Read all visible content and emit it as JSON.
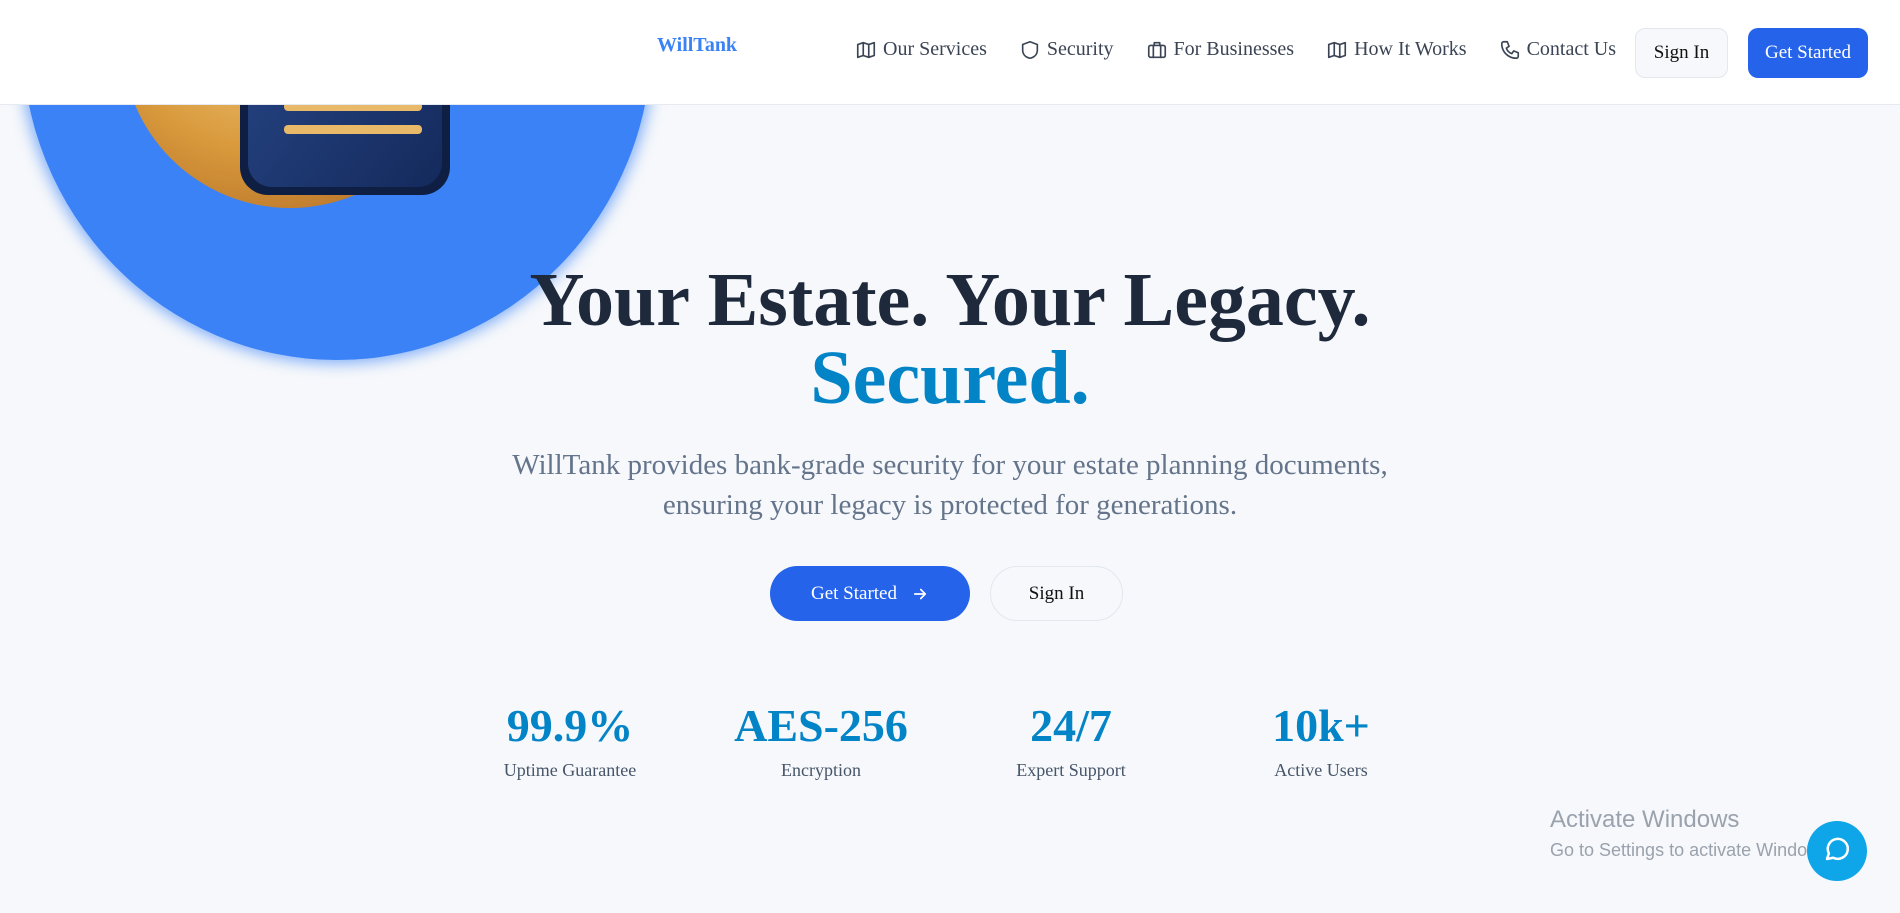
{
  "brand": {
    "name": "WillTank"
  },
  "nav": {
    "items": [
      {
        "label": "Our Services",
        "icon": "map-icon"
      },
      {
        "label": "Security",
        "icon": "shield-icon"
      },
      {
        "label": "For Businesses",
        "icon": "briefcase-icon"
      },
      {
        "label": "How It Works",
        "icon": "map-icon"
      },
      {
        "label": "Contact Us",
        "icon": "phone-icon"
      }
    ],
    "sign_in": "Sign In",
    "get_started": "Get Started"
  },
  "hero": {
    "title_line1": "Your Estate. Your Legacy.",
    "title_line2": "Secured.",
    "subtitle_line1": "WillTank provides bank-grade security for your estate planning documents,",
    "subtitle_line2": "ensuring your legacy is protected for generations.",
    "cta_primary": "Get Started",
    "cta_secondary": "Sign In"
  },
  "stats": [
    {
      "value": "99.9%",
      "label": "Uptime Guarantee"
    },
    {
      "value": "AES-256",
      "label": "Encryption"
    },
    {
      "value": "24/7",
      "label": "Expert Support"
    },
    {
      "value": "10k+",
      "label": "Active Users"
    }
  ],
  "watermark": {
    "line1": "Activate Windows",
    "line2": "Go to Settings to activate Windows."
  },
  "colors": {
    "accent": "#2563eb",
    "highlight": "#0284c7",
    "circle": "#3b82f6"
  }
}
